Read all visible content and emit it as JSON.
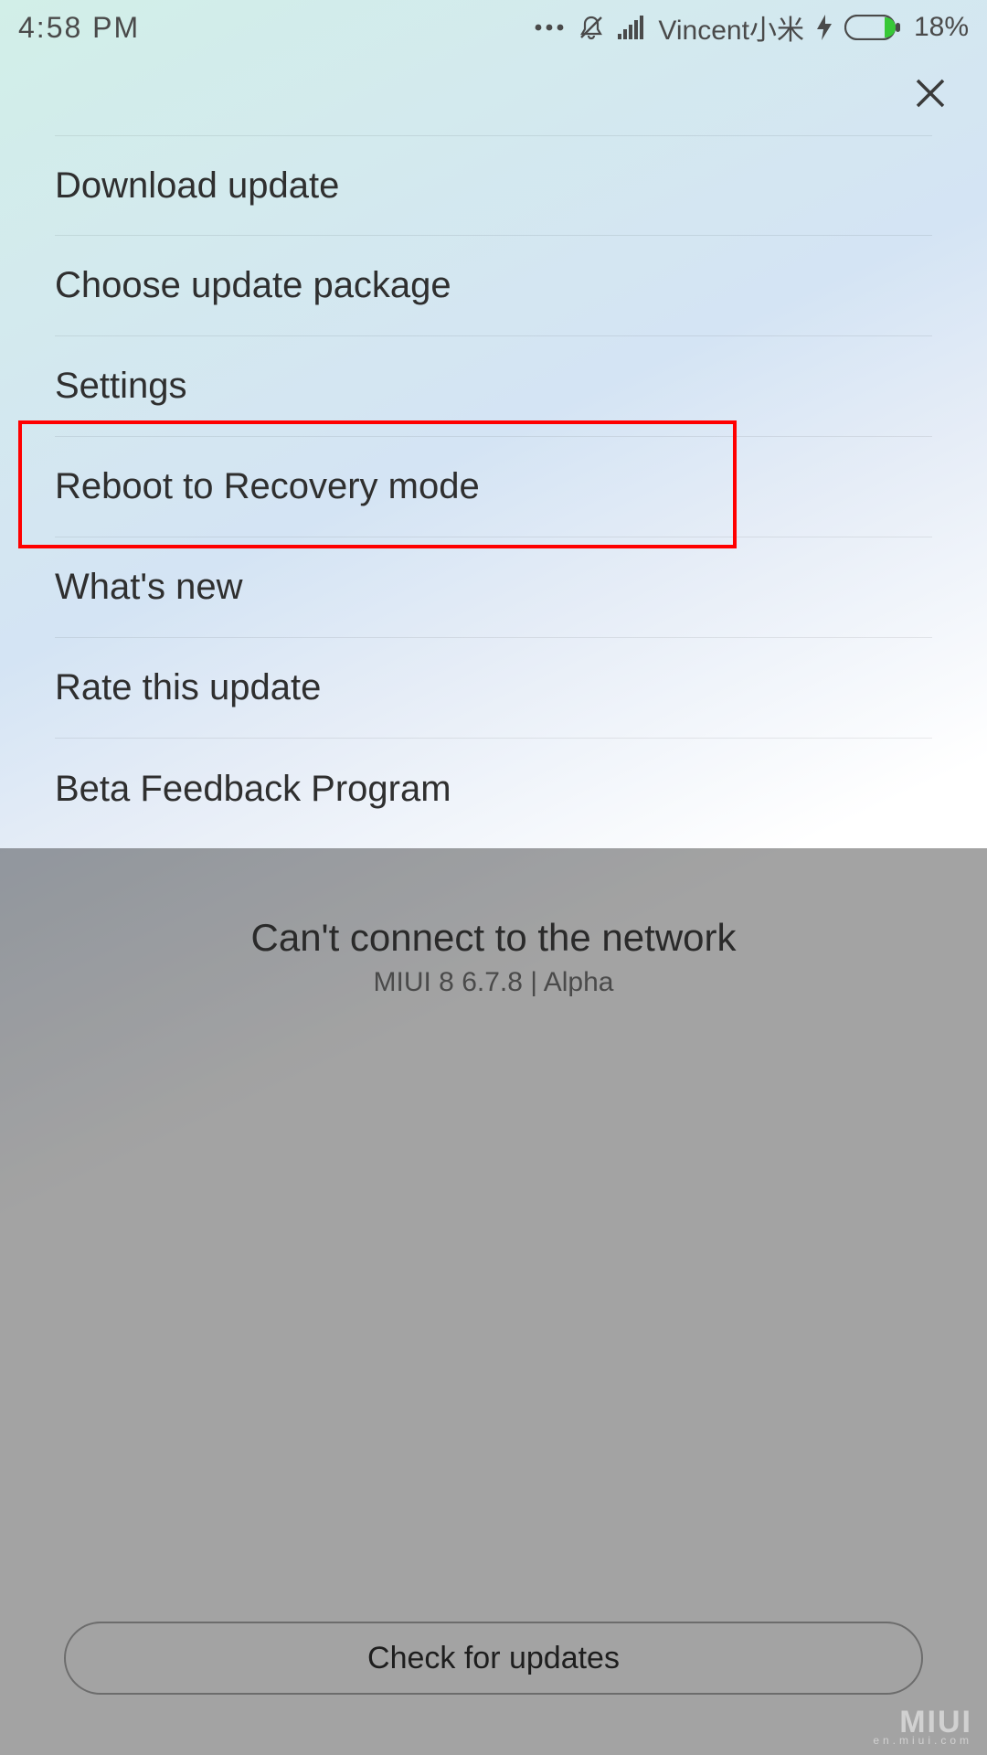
{
  "statusbar": {
    "time": "4:58  PM",
    "carrier": "Vincent小米",
    "battery_pct": "18%"
  },
  "menu": {
    "items": [
      {
        "label": "Download update"
      },
      {
        "label": "Choose update package"
      },
      {
        "label": "Settings"
      },
      {
        "label": "Reboot to Recovery mode"
      },
      {
        "label": "What's new"
      },
      {
        "label": "Rate this update"
      },
      {
        "label": "Beta Feedback Program"
      }
    ]
  },
  "main": {
    "network_message": "Can't connect to the network",
    "version": "MIUI 8 6.7.8 | Alpha",
    "check_button": "Check for updates"
  },
  "watermark": {
    "main": "MIUI",
    "sub": "en.miui.com"
  },
  "annotation": {
    "highlighted_item_index": 3
  }
}
